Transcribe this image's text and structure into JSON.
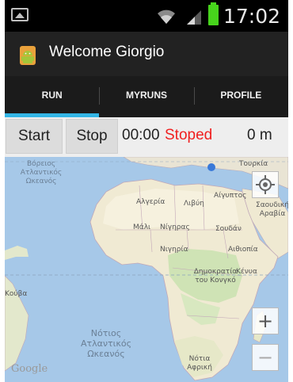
{
  "status_bar": {
    "time": "17:02",
    "icons": [
      "image-icon",
      "wifi-icon",
      "signal-icon",
      "battery-icon"
    ]
  },
  "action_bar": {
    "title": "Welcome Giorgio",
    "icon": "android-icon"
  },
  "tabs": [
    {
      "label": "RUN",
      "active": true
    },
    {
      "label": "MYRUNS",
      "active": false
    },
    {
      "label": "PROFILE",
      "active": false
    }
  ],
  "controls": {
    "start_label": "Start",
    "stop_label": "Stop",
    "timer": "00:00",
    "status": "Stoped",
    "distance": "0 m"
  },
  "map": {
    "labels": {
      "north_atlantic": "Βόρειος\nΑτλαντικός\nΩκεανός",
      "south_atlantic": "Νότιος\nΑτλαντικός\nΩκεανός",
      "algeria": "Αλγερία",
      "libya": "Λιβύη",
      "egypt": "Αίγυπτος",
      "mali": "Μάλι",
      "niger": "Νίγηρας",
      "sudan": "Σουδάν",
      "nigeria": "Νιγηρία",
      "ethiopia": "Αιθιοπία",
      "drc": "Δημοκρατία\nτου Κονγκό",
      "kenya": "Κένυα",
      "saudi": "Σαουδική\nΑραβία",
      "turkey": "Τουρκία",
      "cuba": "Κούβα",
      "south_africa": "Νότια\nΑφρική",
      "credit": "Google"
    },
    "zoom_in": "+",
    "zoom_out": "−"
  },
  "colors": {
    "accent": "#33b5e5",
    "status_stopped": "#f02020",
    "battery": "#47d41c"
  }
}
